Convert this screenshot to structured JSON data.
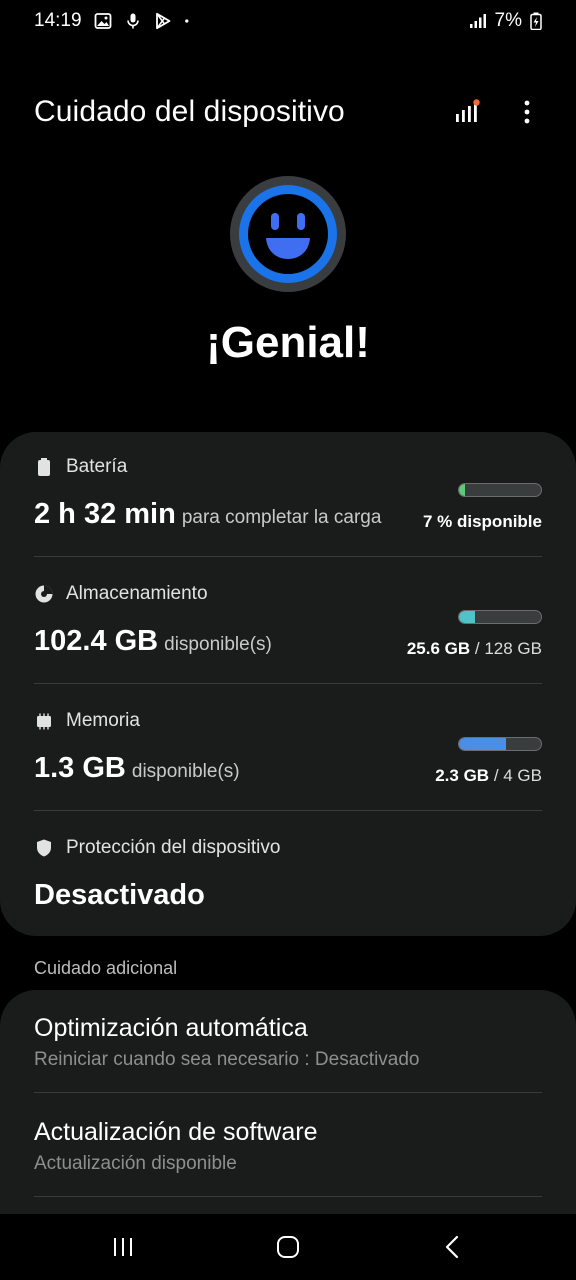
{
  "status_bar": {
    "time": "14:19",
    "battery_percent": "7%",
    "icons": [
      "gallery-icon",
      "mic-icon",
      "play-store-icon",
      "dot-icon",
      "signal-icon",
      "battery-charging-icon"
    ]
  },
  "header": {
    "title": "Cuidado del dispositivo",
    "actions": [
      "diagnostics-icon",
      "more-options-icon"
    ]
  },
  "status": {
    "text": "¡Genial!",
    "icon": "smiley-face-icon",
    "ring_color": "#1a73e8"
  },
  "sections": {
    "battery": {
      "label": "Batería",
      "value": "2 h 32 min",
      "sub": "para completar la carga",
      "right_text": "7 % disponible",
      "level": 0.07,
      "color": "#5ecb7a"
    },
    "storage": {
      "label": "Almacenamiento",
      "value": "102.4 GB",
      "sub": "disponible(s)",
      "used": "25.6 GB",
      "total": "/ 128 GB",
      "level": 0.2,
      "color": "#4fc3c8"
    },
    "memory": {
      "label": "Memoria",
      "value": "1.3 GB",
      "sub": "disponible(s)",
      "used": "2.3 GB",
      "total": "/ 4 GB",
      "level": 0.575,
      "color": "#4a8ee6"
    },
    "protection": {
      "label": "Protección del dispositivo",
      "value": "Desactivado"
    }
  },
  "additional": {
    "heading": "Cuidado adicional",
    "items": [
      {
        "title": "Optimización automática",
        "subtitle": "Reiniciar cuando sea necesario : Desactivado"
      },
      {
        "title": "Actualización de software",
        "subtitle": "Actualización disponible"
      }
    ]
  },
  "navbar": {
    "buttons": [
      "recent-apps-icon",
      "home-icon",
      "back-icon"
    ]
  }
}
